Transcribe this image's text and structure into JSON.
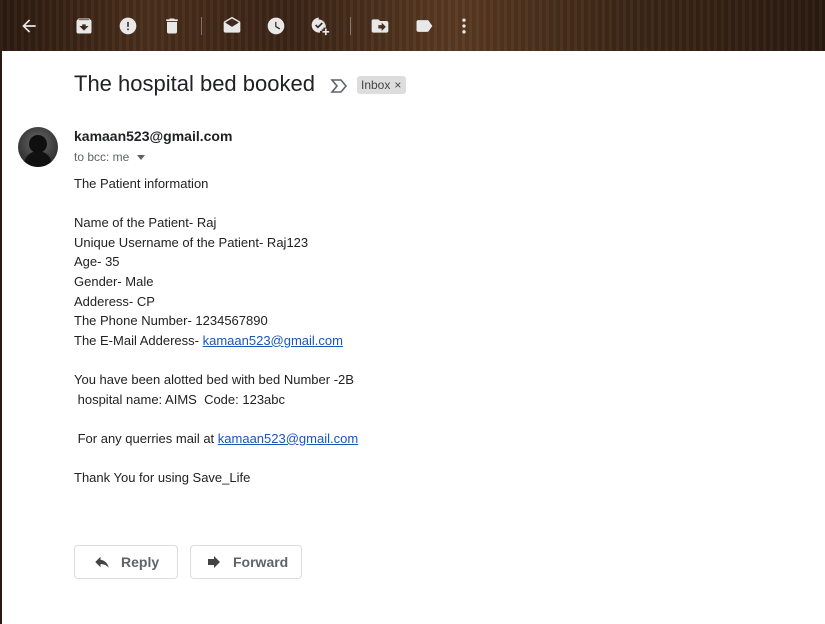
{
  "toolbar": {
    "buttons": [
      {
        "name": "back-arrow-icon"
      },
      {
        "name": "archive-icon"
      },
      {
        "name": "report-spam-icon"
      },
      {
        "name": "delete-icon"
      },
      {
        "name": "mark-unread-icon"
      },
      {
        "name": "snooze-icon"
      },
      {
        "name": "add-to-tasks-icon"
      },
      {
        "name": "move-to-icon"
      },
      {
        "name": "label-icon"
      },
      {
        "name": "more-vert-icon"
      }
    ]
  },
  "email": {
    "subject": "The hospital bed booked",
    "label": "Inbox",
    "label_close": "×",
    "sender": "kamaan523@gmail.com",
    "recipient": "to bcc: me",
    "body": {
      "intro": "The Patient information",
      "patient_name": "Name of the Patient- Raj",
      "username": "Unique Username of the Patient- Raj123",
      "age": "Age- 35",
      "gender": "Gender- Male",
      "address": "Adderess- CP",
      "phone": "The Phone Number- 1234567890",
      "email_prefix": "The E-Mail Adderess- ",
      "email_link": "kamaan523@gmail.com",
      "bed_line": "You have been alotted bed with bed Number -2B",
      "hospital_line": " hospital name: AIMS  Code: 123abc",
      "queries_prefix": " For any querries mail at ",
      "queries_link": "kamaan523@gmail.com",
      "thanks": "Thank You for using Save_Life"
    }
  },
  "actions": {
    "reply_label": "Reply",
    "forward_label": "Forward"
  }
}
